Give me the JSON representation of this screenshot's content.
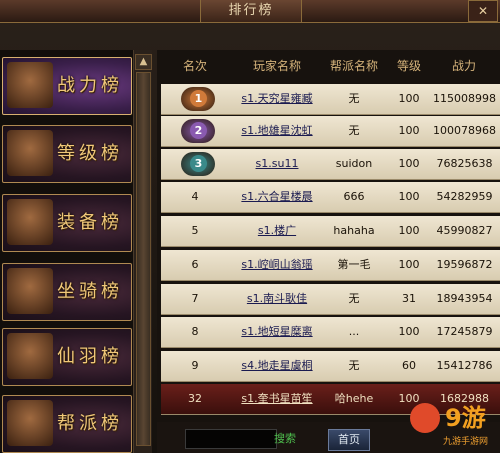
{
  "window": {
    "title": "排行榜",
    "close_label": "✕"
  },
  "sidebar": {
    "items": [
      {
        "label": "战力榜",
        "active": true,
        "icon": "warrior-portrait-icon"
      },
      {
        "label": "等级榜",
        "active": false,
        "icon": "white-hair-portrait-icon"
      },
      {
        "label": "装备榜",
        "active": false,
        "icon": "armor-icon"
      },
      {
        "label": "坐骑榜",
        "active": false,
        "icon": "horse-mount-icon"
      },
      {
        "label": "仙羽榜",
        "active": false,
        "icon": "wings-icon"
      },
      {
        "label": "帮派榜",
        "active": false,
        "icon": "guild-emblem-icon"
      }
    ]
  },
  "table": {
    "headers": [
      "名次",
      "玩家名称",
      "帮派名称",
      "等级",
      "战力"
    ],
    "rows": [
      {
        "rank": "1",
        "player": "s1.天究星雍臧",
        "guild": "无",
        "level": "100",
        "power": "115008998",
        "medal": "#d07a3a"
      },
      {
        "rank": "2",
        "player": "s1.地雄星沈虹",
        "guild": "无",
        "level": "100",
        "power": "100078968",
        "medal": "#8a5ab0"
      },
      {
        "rank": "3",
        "player": "s1.su11",
        "guild": "suidon",
        "level": "100",
        "power": "76825638",
        "medal": "#3a8a8a"
      },
      {
        "rank": "4",
        "player": "s1.六合星楼晨",
        "guild": "666",
        "level": "100",
        "power": "54282959"
      },
      {
        "rank": "5",
        "player": "s1.楼广",
        "guild": "hahaha",
        "level": "100",
        "power": "45990827"
      },
      {
        "rank": "6",
        "player": "s1.崆峒山翁瑶",
        "guild": "第一毛",
        "level": "100",
        "power": "19596872"
      },
      {
        "rank": "7",
        "player": "s1.南斗耿佳",
        "guild": "无",
        "level": "31",
        "power": "18943954"
      },
      {
        "rank": "8",
        "player": "s1.地短星糜离",
        "guild": "...",
        "level": "100",
        "power": "17245879"
      },
      {
        "rank": "9",
        "player": "s4.地走星虞桐",
        "guild": "无",
        "level": "60",
        "power": "15412786"
      },
      {
        "rank": "32",
        "player": "s1.奎书星苗笙",
        "guild": "哈hehe",
        "level": "100",
        "power": "1682988",
        "highlight": true
      }
    ]
  },
  "bottom": {
    "search_value": "",
    "search_label": "搜索",
    "page_label": "首页"
  },
  "watermark": {
    "text": "9游",
    "sub": "九游手游网"
  }
}
